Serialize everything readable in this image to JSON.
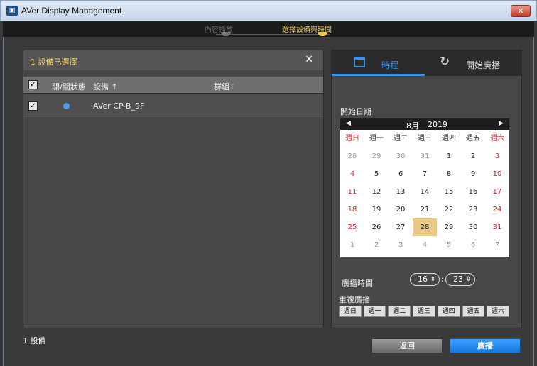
{
  "window": {
    "title": "AVer Display Management",
    "close_glyph": "✕",
    "icon": "app-icon"
  },
  "steps": [
    {
      "label": "內容播放",
      "state": "done"
    },
    {
      "label": "選擇設備與時間",
      "state": "active"
    }
  ],
  "selection": {
    "count_text": "1 設備已選擇",
    "clear_glyph": "✕"
  },
  "device_table": {
    "headers": {
      "status": "開/關狀態",
      "device": "設備",
      "device_sort": "↑",
      "group": "群組",
      "group_sort": "↑"
    },
    "rows": [
      {
        "checked": true,
        "status_color": "#4a9ff5",
        "name": "AVer CP-B_9F"
      }
    ]
  },
  "footer": {
    "device_count": "1 設備",
    "back_label": "返回",
    "broadcast_label": "廣播"
  },
  "tabs": {
    "schedule": "時程",
    "play_now": "開始廣播",
    "active": "schedule"
  },
  "schedule": {
    "start_date_label": "開始日期",
    "calendar": {
      "prev": "◀",
      "next": "▶",
      "month": "8月",
      "year": "2019",
      "weekdays": [
        "週日",
        "週一",
        "週二",
        "週三",
        "週四",
        "週五",
        "週六"
      ],
      "days": [
        [
          "28",
          "29",
          "30",
          "31",
          "1",
          "2",
          "3"
        ],
        [
          "4",
          "5",
          "6",
          "7",
          "8",
          "9",
          "10"
        ],
        [
          "11",
          "12",
          "13",
          "14",
          "15",
          "16",
          "17"
        ],
        [
          "18",
          "19",
          "20",
          "21",
          "22",
          "23",
          "24"
        ],
        [
          "25",
          "26",
          "27",
          "28",
          "29",
          "30",
          "31"
        ],
        [
          "1",
          "2",
          "3",
          "4",
          "5",
          "6",
          "7"
        ]
      ],
      "outside_month": [
        [
          true,
          true,
          true,
          true,
          false,
          false,
          false
        ],
        [
          false,
          false,
          false,
          false,
          false,
          false,
          false
        ],
        [
          false,
          false,
          false,
          false,
          false,
          false,
          false
        ],
        [
          false,
          false,
          false,
          false,
          false,
          false,
          false
        ],
        [
          false,
          false,
          false,
          false,
          false,
          false,
          false
        ],
        [
          true,
          true,
          true,
          true,
          true,
          true,
          true
        ]
      ],
      "selected": "28"
    },
    "broadcast_time_label": "廣播時間",
    "hour": "16",
    "minute": "23",
    "separator": ":",
    "spin_glyph": "⇕",
    "repeat_label": "重複廣播",
    "repeat_days": [
      "週日",
      "週一",
      "週二",
      "週三",
      "週四",
      "週五",
      "週六"
    ]
  },
  "colors": {
    "accent": "#3e91e8",
    "active_step": "#f0d070",
    "selected_day": "#e8c985",
    "weekend": "#d42020",
    "broadcast": "#1a84ee"
  }
}
